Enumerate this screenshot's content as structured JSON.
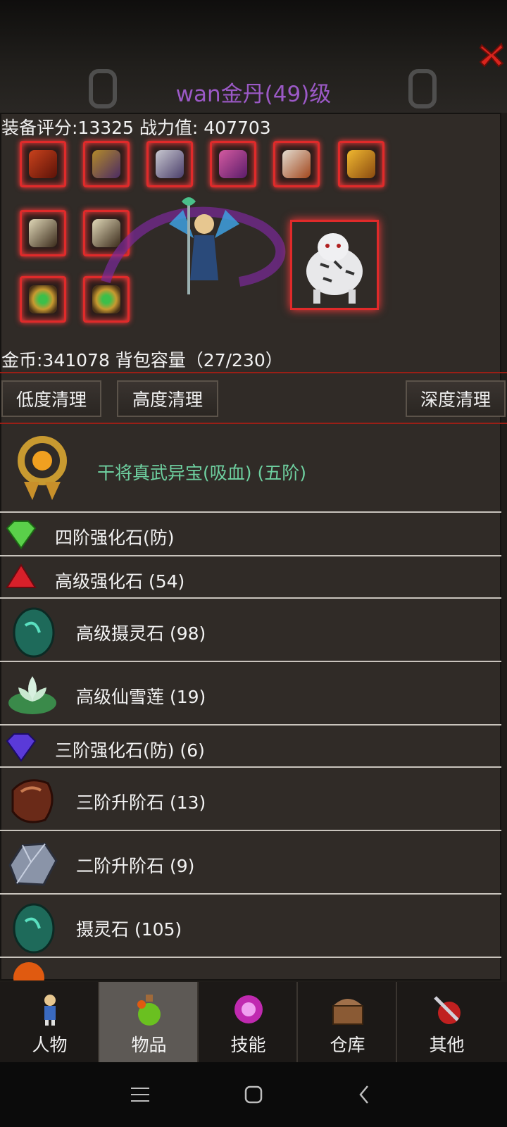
{
  "title": "wan金丹(49)级",
  "stats": {
    "equip_score": "装备评分:13325",
    "power": "战力值:  407703"
  },
  "gold_line": "金币:341078 背包容量（27/230）",
  "buttons": {
    "low_clean": "低度清理",
    "high_clean": "高度清理",
    "deep_clean": "深度清理"
  },
  "items": [
    {
      "name": "干将真武异宝(吸血) (五阶)",
      "color": "#6ed0a0",
      "icon": "treasure-ring-icon"
    },
    {
      "name": "四阶强化石(防)",
      "color": "#f2f2f2",
      "icon": "green-gem-icon"
    },
    {
      "name": "高级强化石 (54)",
      "color": "#f2f2f2",
      "icon": "red-gem-icon"
    },
    {
      "name": "高级摄灵石 (98)",
      "color": "#f2f2f2",
      "icon": "spirit-stone-icon"
    },
    {
      "name": "高级仙雪莲 (19)",
      "color": "#f2f2f2",
      "icon": "snow-lotus-icon"
    },
    {
      "name": "三阶强化石(防) (6)",
      "color": "#f2f2f2",
      "icon": "purple-gem-icon"
    },
    {
      "name": "三阶升阶石 (13)",
      "color": "#f2f2f2",
      "icon": "brown-stone-icon"
    },
    {
      "name": "二阶升阶石 (9)",
      "color": "#f2f2f2",
      "icon": "silver-stone-icon"
    },
    {
      "name": "摄灵石 (105)",
      "color": "#f2f2f2",
      "icon": "spirit-stone-icon"
    }
  ],
  "nav": [
    {
      "label": "人物",
      "icon": "character-icon"
    },
    {
      "label": "物品",
      "icon": "potion-icon"
    },
    {
      "label": "技能",
      "icon": "skill-orb-icon"
    },
    {
      "label": "仓库",
      "icon": "chest-icon"
    },
    {
      "label": "其他",
      "icon": "sword-shield-icon"
    }
  ],
  "colors": {
    "title": "#9b59c6",
    "frame_red": "#e02a2a",
    "panel": "#302b27",
    "nav_active": "#5d5955"
  }
}
